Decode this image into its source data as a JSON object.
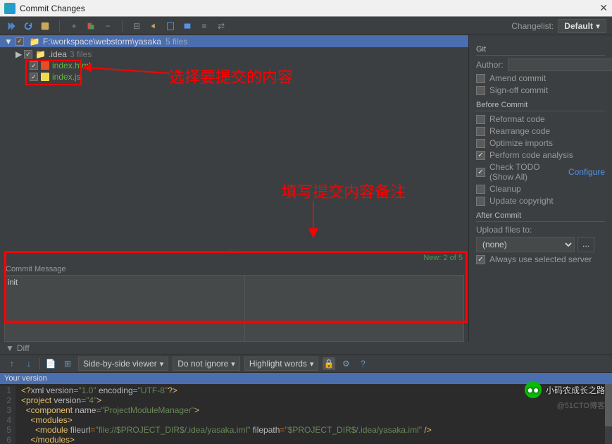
{
  "window": {
    "title": "Commit Changes"
  },
  "changelist": {
    "label": "Changelist:",
    "value": "Default"
  },
  "tree": {
    "root": "F:\\workspace\\webstorm\\yasaka",
    "root_count": "5 files",
    "idea_folder": ".idea",
    "idea_count": "3 files",
    "files": [
      "index.html",
      "index.js"
    ]
  },
  "stats": "New: 2 of 5",
  "commit": {
    "label": "Commit Message",
    "value": "init"
  },
  "annotations": {
    "select": "选择要提交的内容",
    "remark": "填写提交内容备注"
  },
  "diff": {
    "label": "Diff",
    "viewer": "Side-by-side viewer",
    "ignore": "Do not ignore",
    "highlight": "Highlight words",
    "your_version": "Your version"
  },
  "git": {
    "title": "Git",
    "author_label": "Author:",
    "amend": "Amend commit",
    "signoff": "Sign-off commit",
    "before_title": "Before Commit",
    "reformat": "Reformat code",
    "rearrange": "Rearrange code",
    "optimize": "Optimize imports",
    "analysis": "Perform code analysis",
    "todo": "Check TODO (Show All)",
    "configure": "Configure",
    "cleanup": "Cleanup",
    "copyright": "Update copyright",
    "after_title": "After Commit",
    "upload_label": "Upload files to:",
    "upload_value": "(none)",
    "always_server": "Always use selected server"
  },
  "code": [
    "<?xml version=\"1.0\" encoding=\"UTF-8\"?>",
    "<project version=\"4\">",
    "  <component name=\"ProjectModuleManager\">",
    "    <modules>",
    "      <module fileurl=\"file://$PROJECT_DIR$/.idea/yasaka.iml\" filepath=\"$PROJECT_DIR$/.idea/yasaka.iml\" />",
    "    </modules>"
  ],
  "watermark": "小码农成长之路",
  "blogmark": "@51CTO博客"
}
